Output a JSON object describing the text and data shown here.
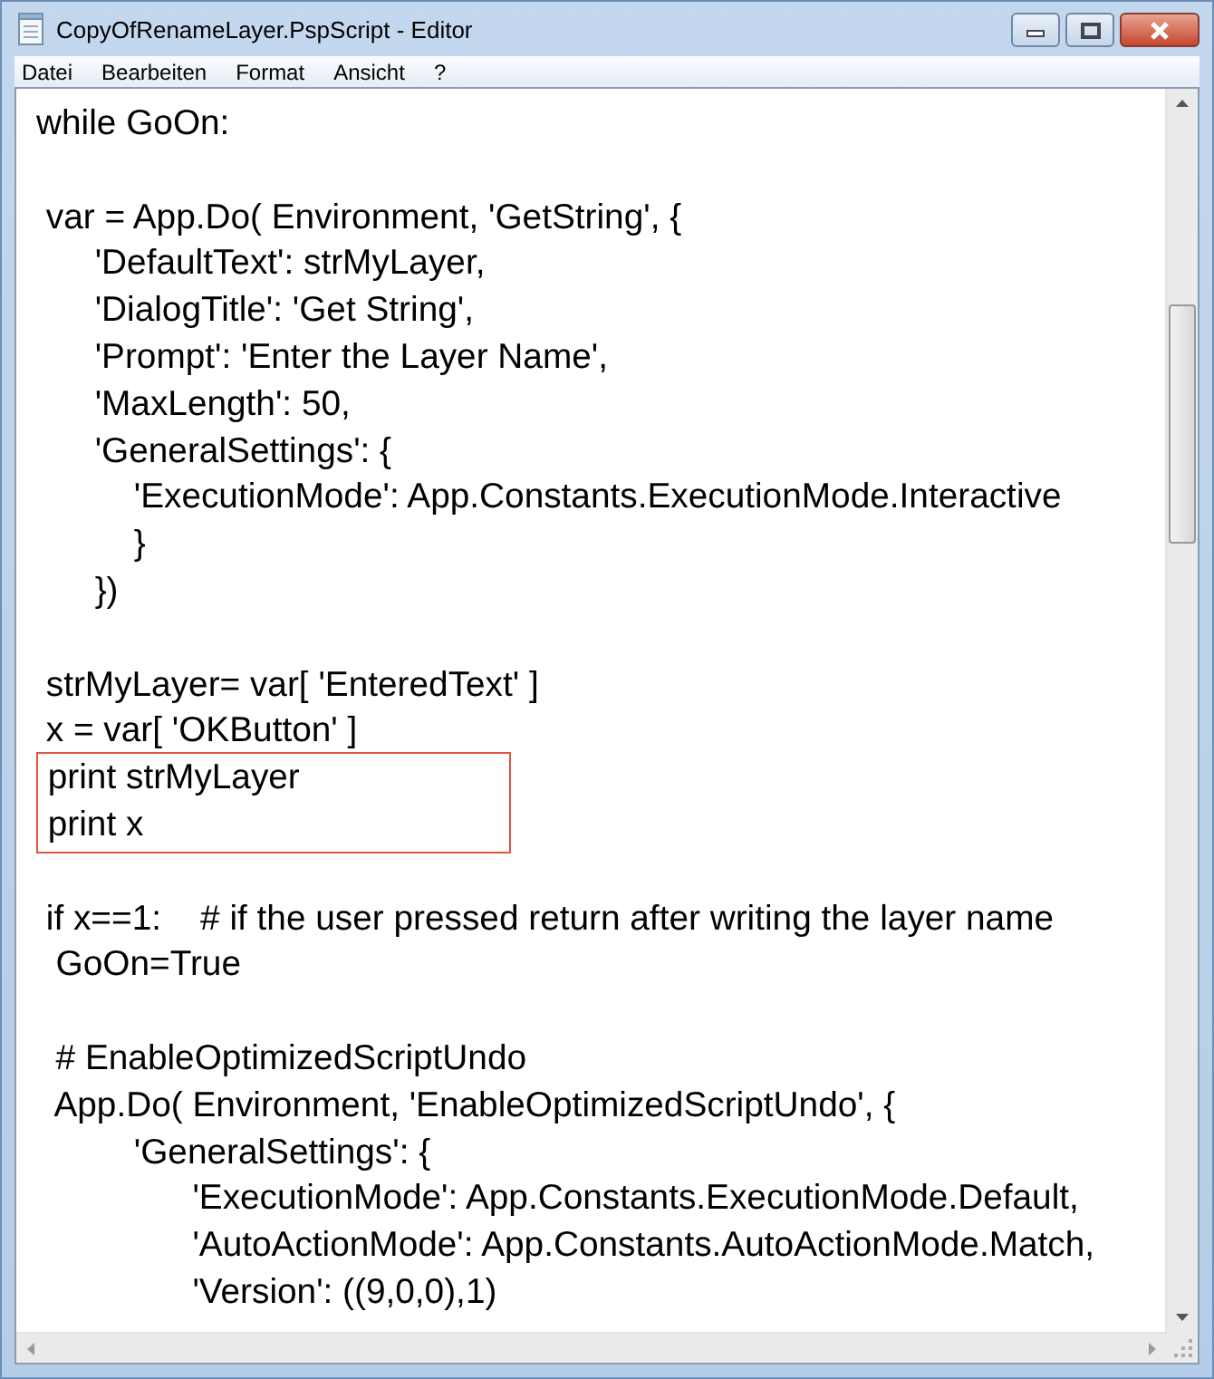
{
  "window": {
    "title": "CopyOfRenameLayer.PspScript - Editor"
  },
  "menu": [
    "Datei",
    "Bearbeiten",
    "Format",
    "Ansicht",
    "?"
  ],
  "editor": {
    "blocks": [
      {
        "highlighted": false,
        "lines": [
          {
            "kind": "code",
            "text": "while GoOn:"
          },
          {
            "kind": "blank"
          },
          {
            "kind": "code",
            "text": " var = App.Do( Environment, 'GetString', {"
          },
          {
            "kind": "code",
            "text": "      'DefaultText': strMyLayer,"
          },
          {
            "kind": "code",
            "text": "      'DialogTitle': 'Get String',"
          },
          {
            "kind": "code",
            "text": "      'Prompt': 'Enter the Layer Name',"
          },
          {
            "kind": "code",
            "text": "      'MaxLength': 50,"
          },
          {
            "kind": "code",
            "text": "      'GeneralSettings': {"
          },
          {
            "kind": "code",
            "text": "          'ExecutionMode': App.Constants.ExecutionMode.Interactive"
          },
          {
            "kind": "code",
            "text": "          }"
          },
          {
            "kind": "code",
            "text": "      })"
          },
          {
            "kind": "blank"
          },
          {
            "kind": "code",
            "text": " strMyLayer= var[ 'EnteredText' ]"
          },
          {
            "kind": "code",
            "text": " x = var[ 'OKButton' ]"
          }
        ]
      },
      {
        "highlighted": true,
        "lines": [
          {
            "kind": "code",
            "text": " print strMyLayer"
          },
          {
            "kind": "code",
            "text": " print x"
          }
        ]
      },
      {
        "highlighted": false,
        "lines": [
          {
            "kind": "blank"
          },
          {
            "kind": "code",
            "text": " if x==1:    # if the user pressed return after writing the layer name"
          },
          {
            "kind": "code",
            "text": "  GoOn=True"
          },
          {
            "kind": "blank"
          },
          {
            "kind": "code",
            "text": "  # EnableOptimizedScriptUndo"
          },
          {
            "kind": "code",
            "text": "  App.Do( Environment, 'EnableOptimizedScriptUndo', {"
          },
          {
            "kind": "code",
            "text": "          'GeneralSettings': {"
          },
          {
            "kind": "code",
            "text": "                'ExecutionMode': App.Constants.ExecutionMode.Default,"
          },
          {
            "kind": "code",
            "text": "                'AutoActionMode': App.Constants.AutoActionMode.Match,"
          },
          {
            "kind": "code",
            "text": "                'Version': ((9,0,0),1)"
          }
        ]
      }
    ]
  }
}
